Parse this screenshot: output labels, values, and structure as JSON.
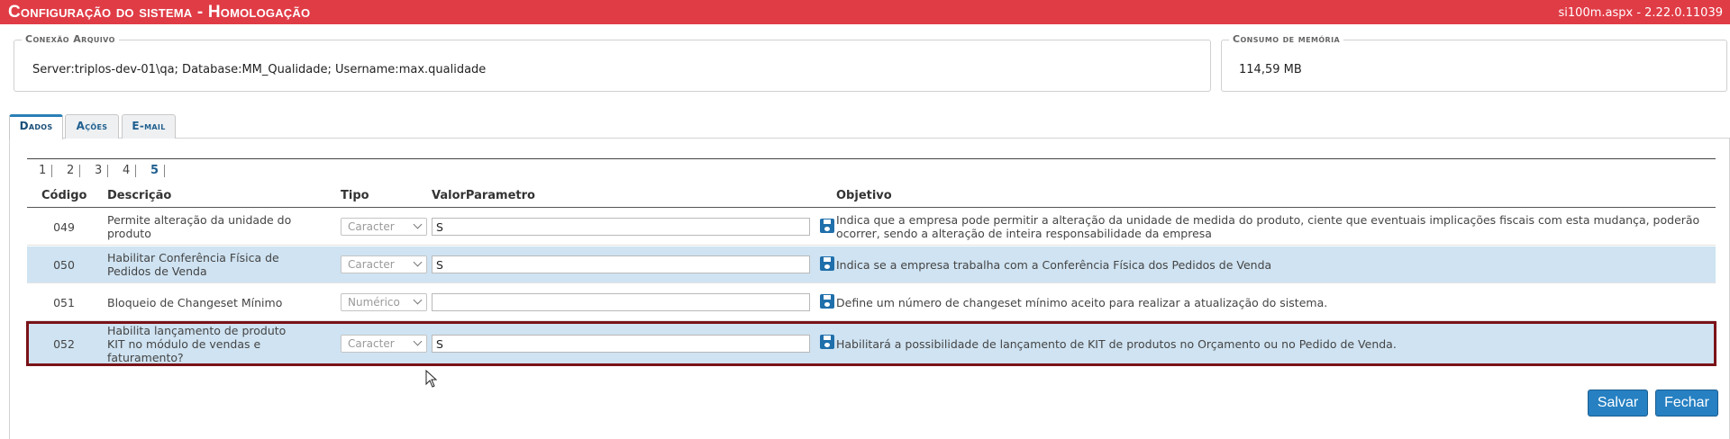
{
  "header": {
    "title": "Configuração do sistema  - Homologação",
    "version": "si100m.aspx - 2.22.0.11039"
  },
  "connection": {
    "legend": "Conexão Arquivo",
    "value": "Server:triplos-dev-01\\qa; Database:MM_Qualidade; Username:max.qualidade"
  },
  "memory": {
    "legend": "Consumo de memória",
    "value": "114,59 MB"
  },
  "tabs": [
    {
      "label": "Dados",
      "active": true
    },
    {
      "label": "Ações",
      "active": false
    },
    {
      "label": "E-mail",
      "active": false
    }
  ],
  "pager": {
    "pages": [
      "1",
      "2",
      "3",
      "4",
      "5"
    ],
    "current": "5"
  },
  "grid": {
    "columns": {
      "codigo": "Código",
      "descricao": "Descrição",
      "tipo": "Tipo",
      "valor": "ValorParametro",
      "objetivo": "Objetivo"
    },
    "rows": [
      {
        "codigo": "049",
        "descricao": "Permite alteração da unidade do produto",
        "tipo": "Caracter",
        "valor": "S",
        "objetivo": "Indica que a empresa pode permitir a alteração da unidade de medida do produto, ciente que eventuais implicações fiscais com esta mudança, poderão ocorrer, sendo a alteração de inteira responsabilidade da empresa"
      },
      {
        "codigo": "050",
        "descricao": "Habilitar Conferência Física de Pedidos de Venda",
        "tipo": "Caracter",
        "valor": "S",
        "objetivo": "Indica se a empresa trabalha com a Conferência Física dos Pedidos de Venda"
      },
      {
        "codigo": "051",
        "descricao": "Bloqueio de Changeset Mínimo",
        "tipo": "Numérico",
        "valor": "",
        "objetivo": "Define um número de changeset mínimo aceito para realizar a atualização do sistema."
      },
      {
        "codigo": "052",
        "descricao": "Habilita lançamento de produto KIT no módulo de vendas e faturamento?",
        "tipo": "Caracter",
        "valor": "S",
        "objetivo": "Habilitará a possibilidade de lançamento de KIT de produtos no Orçamento ou no Pedido de Venda."
      }
    ]
  },
  "actions": {
    "save_label": "Salvar",
    "close_label": "Fechar"
  },
  "colors": {
    "titlebar": "#e03c46",
    "accent": "#2680c2",
    "row_alt": "#cfe3f2",
    "highlight_border": "#7a1218"
  }
}
